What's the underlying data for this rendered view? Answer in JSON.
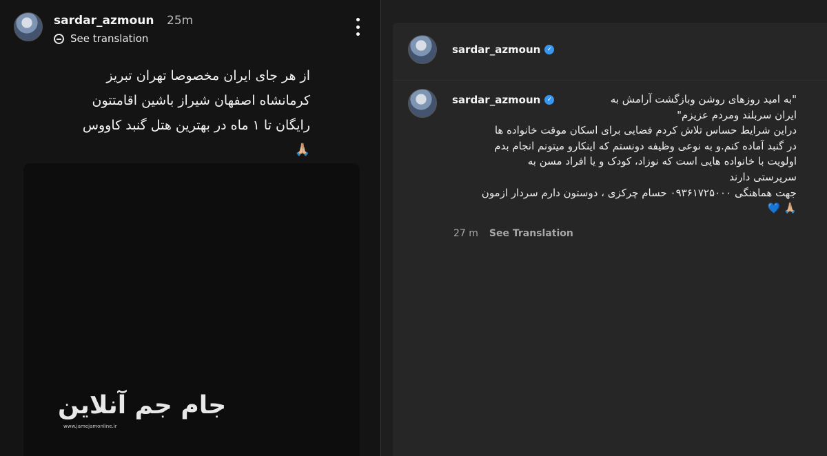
{
  "story": {
    "username": "sardar_azmoun",
    "time": "25m",
    "see_translation": "See translation",
    "text_lines": [
      "از هر جای ایران مخصوصا تهران تبریز",
      "کرمانشاه اصفهان شیراز باشین اقامتتون",
      "رایگان تا ۱ ماه در بهترین هتل گنبد کاووس"
    ],
    "emoji": "🙏🏼",
    "watermark": {
      "name": "جام جم آنلاین",
      "url": "www.jamejamonline.ir"
    }
  },
  "post": {
    "username": "sardar_azmoun",
    "verified_icon": "✓",
    "comment": {
      "username": "sardar_azmoun",
      "lines": [
        "\"به امید روزهای روشن وبازگشت آرامش به",
        "ایران سربلند ومردم عزیزم\"",
        "دراین شرایط حساس تلاش کردم فضایی برای اسکان موقت خانواده ها",
        "در گنبد آماده کنم.و به نوعی وظیفه دونستم که اینکارو میتونم انجام بدم",
        "اولویت با خانواده هایی است که نوزاد، کودک و یا افراد مسن به",
        "سرپرستی دارند",
        "جهت هماهنگی ۰۹۳۶۱۷۲۵۰۰۰ حسام چرکزی ، دوستون دارم سردار ازمون",
        "🙏🏼 💙"
      ],
      "time": "27 m",
      "see_translation": "See Translation"
    }
  },
  "colors": {
    "story_bg": "#141414",
    "post_bg": "#262626",
    "verified": "#3897f0",
    "heart": "#2f8ef0"
  }
}
